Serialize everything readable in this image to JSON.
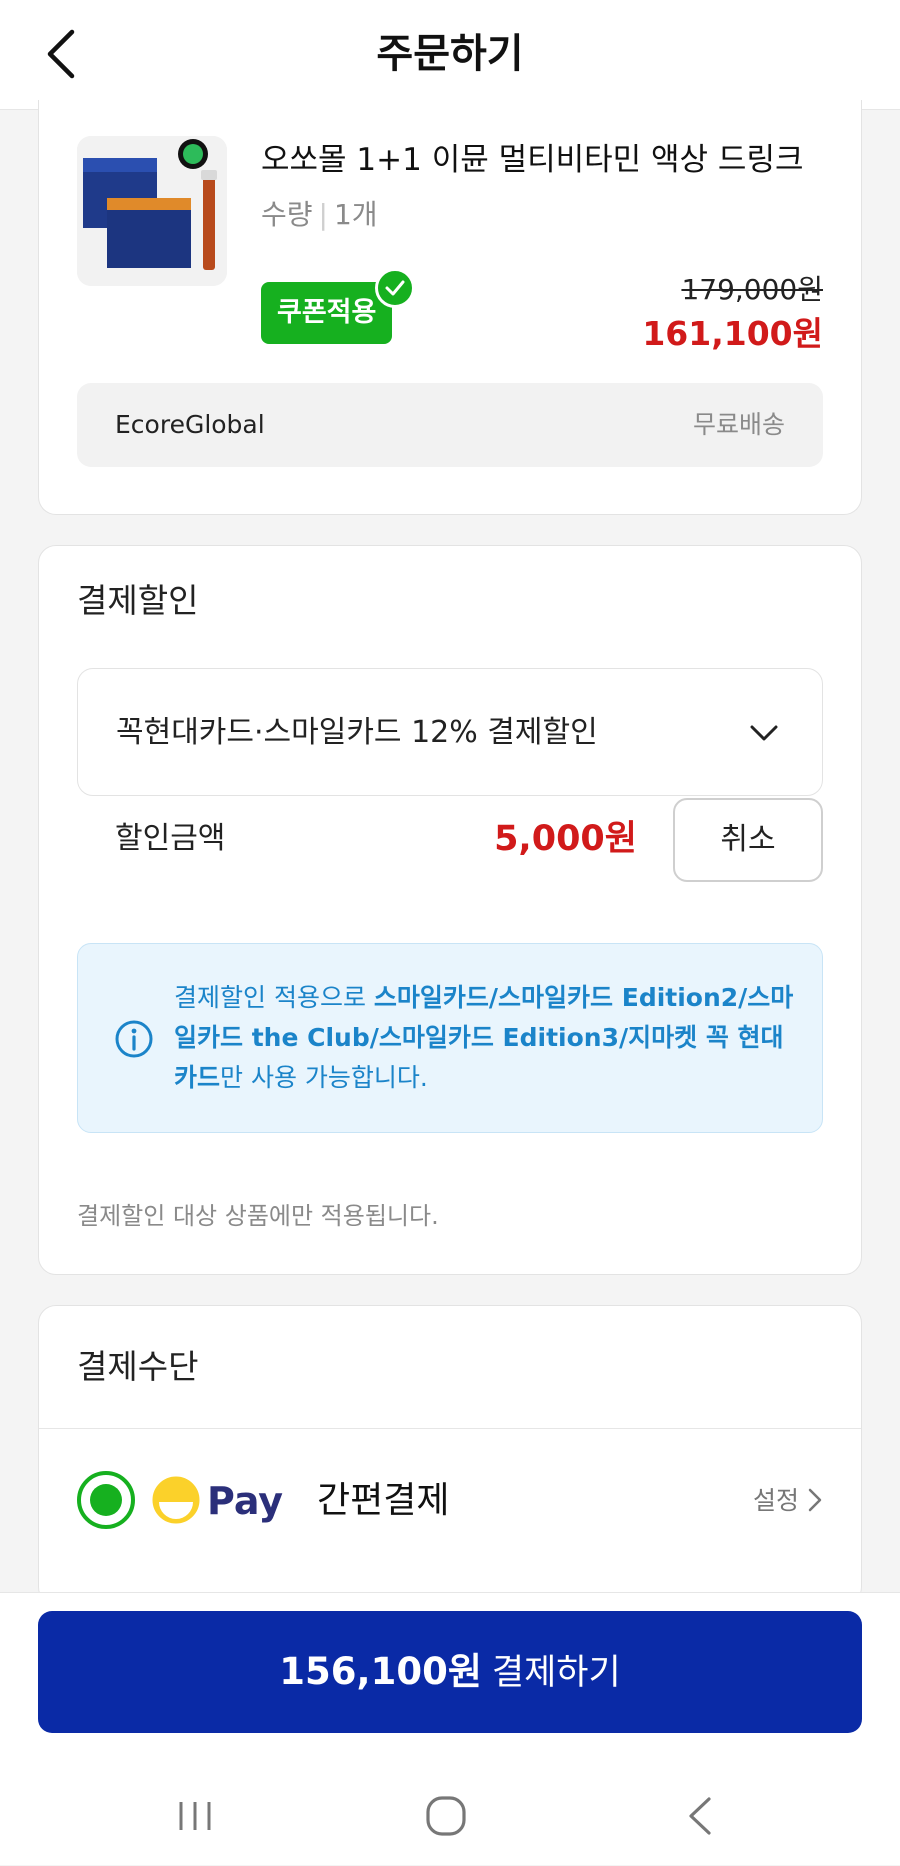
{
  "header": {
    "title": "주문하기"
  },
  "product": {
    "name": "오쏘몰 1+1 이뮨 멀티비타민 액상 드링크",
    "qty_label": "수량",
    "qty_value": "1개",
    "coupon_badge": "쿠폰적용",
    "original_price": "179,000원",
    "sale_price": "161,100원",
    "seller": "EcoreGlobal",
    "shipping": "무료배송"
  },
  "discount": {
    "title": "결제할인",
    "selected_option": "꼭현대카드·스마일카드 12% 결제할인",
    "amount_label": "할인금액",
    "amount_value": "5,000원",
    "cancel_label": "취소",
    "info_prefix": "결제할인 적용으로 ",
    "info_cards": "스마일카드/스마일카드 Edition2/스마일카드 the Club/스마일카드 Edition3/지마켓 꼭 현대카드",
    "info_suffix": "만 사용 가능합니다.",
    "footnote": "결제할인 대상 상품에만 적용됩니다."
  },
  "payment": {
    "title": "결제수단",
    "method_brand": "Pay",
    "method_label": "간편결제",
    "settings_label": "설정"
  },
  "checkout": {
    "total": "156,100원",
    "label": "결제하기"
  },
  "colors": {
    "accent_green": "#16b01f",
    "price_red": "#d11a1a",
    "button_blue": "#0a2aa6",
    "info_blue": "#1b84c9"
  }
}
